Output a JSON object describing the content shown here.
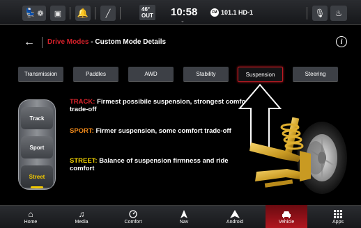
{
  "status_bar": {
    "icons": [
      "climate-seat-icon",
      "alert-icon",
      "notification-bell-icon",
      "wireless-icon",
      "microphone-icon",
      "seat-heat-icon"
    ],
    "outside_temp": "46°",
    "outside_label": "OUT",
    "time": "10:58",
    "radio_badge": "FM",
    "radio_station": "101.1 HD-1"
  },
  "header": {
    "breadcrumb_parent": "Drive Modes",
    "breadcrumb_sep": " - ",
    "title": "Custom Mode Details"
  },
  "tabs": [
    {
      "label": "Transmission"
    },
    {
      "label": "Paddles"
    },
    {
      "label": "AWD"
    },
    {
      "label": "Stability"
    },
    {
      "label": "Suspension"
    },
    {
      "label": "Steering"
    }
  ],
  "active_tab": "Suspension",
  "mode_selector": {
    "options": [
      "Track",
      "Sport",
      "Street"
    ],
    "selected": "Street"
  },
  "descriptions": [
    {
      "key": "TRACK:",
      "text": "Firmest possibile suspension, strongest comfort trade-off",
      "color": "#e0262e"
    },
    {
      "key": "SPORT:",
      "text": "Firmer suspension, some comfort trade-off",
      "color": "#f28a1a"
    },
    {
      "key": "STREET:",
      "text": "Balance of suspension firmness and ride comfort",
      "color": "#f2d200"
    }
  ],
  "bottom_nav": [
    {
      "label": "Home",
      "icon": "home-icon"
    },
    {
      "label": "Media",
      "icon": "music-note-icon"
    },
    {
      "label": "Comfort",
      "icon": "comfort-icon"
    },
    {
      "label": "Nav",
      "icon": "navigation-arrow-icon"
    },
    {
      "label": "Android",
      "icon": "android-auto-icon"
    },
    {
      "label": "Vehicle",
      "icon": "vehicle-icon"
    },
    {
      "label": "Apps",
      "icon": "apps-grid-icon"
    }
  ],
  "active_nav": "Vehicle",
  "colors": {
    "accent_red": "#c41a22",
    "selected_yellow": "#f2c900"
  }
}
